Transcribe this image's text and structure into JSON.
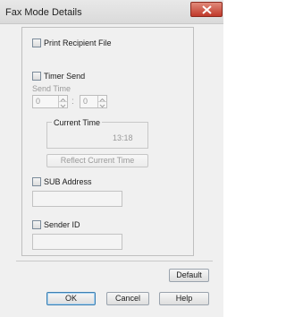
{
  "window": {
    "title": "Fax Mode Details"
  },
  "options": {
    "print_recipient_file": "Print Recipient File",
    "timer_send": "Timer Send",
    "send_time_label": "Send Time",
    "send_time_hour": "0",
    "send_time_separator": ":",
    "send_time_minute": "0",
    "current_time_label": "Current Time",
    "current_time_value": "13:18",
    "reflect_current_time": "Reflect Current Time",
    "sub_address": "SUB Address",
    "sender_id": "Sender ID"
  },
  "buttons": {
    "default": "Default",
    "ok": "OK",
    "cancel": "Cancel",
    "help": "Help"
  }
}
